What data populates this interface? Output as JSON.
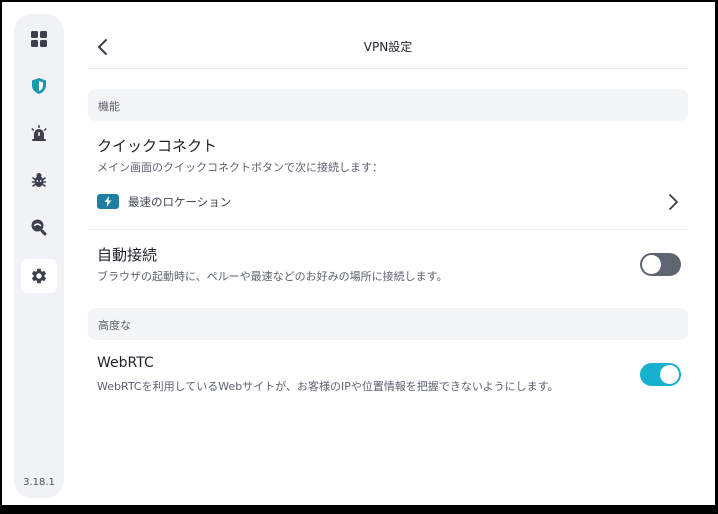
{
  "app": {
    "version": "3.18.1"
  },
  "sidebar": {
    "items": [
      {
        "id": "dashboard",
        "icon": "grid-icon",
        "active": false
      },
      {
        "id": "vpn",
        "icon": "shield-icon",
        "active": false
      },
      {
        "id": "alerts",
        "icon": "alarm-icon",
        "active": false
      },
      {
        "id": "malware",
        "icon": "bug-icon",
        "active": false
      },
      {
        "id": "privacy",
        "icon": "search-eye-icon",
        "active": false
      },
      {
        "id": "settings",
        "icon": "gear-icon",
        "active": true
      }
    ]
  },
  "header": {
    "title": "VPN設定"
  },
  "sections": {
    "features": {
      "label": "機能",
      "quick_connect": {
        "title": "クイックコネクト",
        "description": "メイン画面のクイックコネクトボタンで次に接続します：",
        "selected_location": "最速のロケーション"
      },
      "auto_connect": {
        "title": "自動接続",
        "description": "ブラウザの起動時に、ペルーや最速などのお好みの場所に接続します。",
        "enabled": false
      }
    },
    "advanced": {
      "label": "高度な",
      "webrtc": {
        "title": "WebRTC",
        "description": "WebRTCを利用しているWebサイトが、お客様のIPや位置情報を把握できないようにします。",
        "enabled": true
      }
    }
  },
  "colors": {
    "accent": "#18b0cf",
    "shield": "#1c98ad",
    "toggle_off": "#5e6470",
    "icon_dark": "#3b404c"
  }
}
